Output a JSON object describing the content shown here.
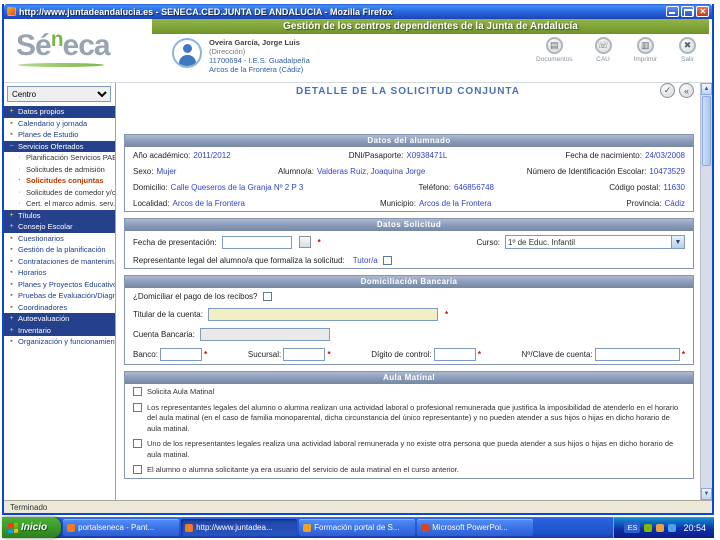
{
  "window": {
    "title": "http://www.juntadeandalucia.es - SENECA.CED.JUNTA DE ANDALUCIA - Mozilla Firefox"
  },
  "header": {
    "banner": "Gestión de los centros dependientes de la Junta de Andalucía",
    "logo": {
      "p1": "Sé",
      "p2": "n",
      "p3": "eca"
    },
    "user": {
      "name": "Oveira García, Jorge Luis",
      "role": "(Dirección)",
      "center": "11700694 - I.E.S. Guadalpeña",
      "location": "Arcos de la Frontera (Cádiz)"
    },
    "actions": [
      {
        "label": "Documentos",
        "glyph": "▤"
      },
      {
        "label": "CAU",
        "glyph": "☏"
      },
      {
        "label": "Imprimir",
        "glyph": "▥"
      },
      {
        "label": "Salir",
        "glyph": "✖"
      }
    ]
  },
  "sidebar": {
    "selector_value": "Centro",
    "items": [
      {
        "label": "Datos propios",
        "type": "dark",
        "prefix": "+"
      },
      {
        "label": "Calendario y jornada",
        "type": "link",
        "prefix": "▪"
      },
      {
        "label": "Planes de Estudio",
        "type": "link",
        "prefix": "▪"
      },
      {
        "label": "Servicios Ofertados",
        "type": "dark",
        "prefix": "−"
      },
      {
        "label": "Planificación Servicios PAE",
        "type": "sub",
        "prefix": "·"
      },
      {
        "label": "Solicitudes de admisión",
        "type": "sub",
        "prefix": "·"
      },
      {
        "label": "Solicitudes conjuntas",
        "type": "subsel",
        "prefix": "·"
      },
      {
        "label": "Solicitudes de comedor y/o aula",
        "type": "sub",
        "prefix": "·"
      },
      {
        "label": "Cert. el marco admis. serv. compl.",
        "type": "sub",
        "prefix": "·"
      },
      {
        "label": "Títulos",
        "type": "dark",
        "prefix": "+"
      },
      {
        "label": "Consejo Escolar",
        "type": "dark",
        "prefix": "+"
      },
      {
        "label": "Cuestionarios",
        "type": "link",
        "prefix": "▪"
      },
      {
        "label": "Gestión de la planificación",
        "type": "link",
        "prefix": "▪"
      },
      {
        "label": "Contrataciones de mantenim.",
        "type": "link",
        "prefix": "▪"
      },
      {
        "label": "Horarios",
        "type": "link",
        "prefix": "▪"
      },
      {
        "label": "Planes y Proyectos Educativos",
        "type": "link",
        "prefix": "▪"
      },
      {
        "label": "Pruebas de Evaluación/Diagnóstico",
        "type": "link",
        "prefix": "▪"
      },
      {
        "label": "Coordinadores",
        "type": "link",
        "prefix": "▪"
      },
      {
        "label": "Autoevaluación",
        "type": "dark",
        "prefix": "+"
      },
      {
        "label": "Inventario",
        "type": "dark",
        "prefix": "+"
      },
      {
        "label": "Organización y funcionamiento de bibl.",
        "type": "link",
        "prefix": "▪"
      }
    ]
  },
  "main": {
    "title": "DETALLE DE LA SOLICITUD CONJUNTA",
    "accept_icon": "✓",
    "back_icon": "«",
    "required": "*",
    "student": {
      "title": "Datos del alumnado",
      "fields": [
        {
          "label": "Año académico:",
          "value": "2011/2012"
        },
        {
          "label": "DNI/Pasaporte:",
          "value": "X0938471L"
        },
        {
          "label": "Fecha de nacimiento:",
          "value": "24/03/2008"
        },
        {
          "label": "Sexo:",
          "value": "Mujer"
        },
        {
          "label": "Alumno/a:",
          "value": "Valderas Ruiz, Joaquina Jorge"
        },
        {
          "label": "Número de Identificación Escolar:",
          "value": "10473529"
        },
        {
          "label": "Domicilio:",
          "value": "Calle Queseros de la Granja Nº 2 P 3"
        },
        {
          "label": "Teléfono:",
          "value": "646856748"
        },
        {
          "label": "Código postal:",
          "value": "11630"
        },
        {
          "label": "Localidad:",
          "value": "Arcos de la Frontera"
        },
        {
          "label": "Municipio:",
          "value": "Arcos de la Frontera"
        },
        {
          "label": "Provincia:",
          "value": "Cádiz"
        }
      ]
    },
    "request": {
      "title": "Datos Solicitud",
      "fecha_label": "Fecha de presentación:",
      "curso_label": "Curso:",
      "curso_value": "1º de Educ. Infantil",
      "rep_label": "Representante legal del alumno/a que formaliza la solicitud:",
      "rep_value": "Tutor/a"
    },
    "bank": {
      "title": "Domiciliación Bancaria",
      "question": "¿Domiciliar el pago de los recibos?",
      "titular_label": "Titular de la cuenta:",
      "cuenta_label": "Cuenta Bancaria:",
      "banco_label": "Banco:",
      "sucursal_label": "Sucursal:",
      "digito_label": "Dígito de control:",
      "clave_label": "Nº/Clave de cuenta:"
    },
    "matinal": {
      "title": "Aula Matinal",
      "options": [
        "Solicita Aula Matinal",
        "Los representantes legales del alumno o alumna realizan una actividad laboral o profesional remunerada que justifica la imposibilidad de atenderlo en el horario del aula matinal (en el caso de familia monoparental, dicha circunstancia del único representante) y no pueden atender a sus hijos o hijas en dicho horario de aula matinal.",
        "Uno de los representantes legales realiza una actividad laboral remunerada y no existe otra persona que pueda atender a sus hijos o hijas en dicho horario de aula matinal.",
        "El alumno o alumna solicitante ya era usuario del servicio de aula matinal en el curso anterior."
      ]
    }
  },
  "statusbar": {
    "text": "Terminado"
  },
  "taskbar": {
    "start_label": "Inicio",
    "buttons": [
      {
        "label": "portalseneca - Pant...",
        "active": "",
        "icon": "#F47B20"
      },
      {
        "label": "http://www.juntadea...",
        "active": "active",
        "icon": "#F47B20"
      },
      {
        "label": "Formación portal de S...",
        "active": "",
        "icon": "#F4A020"
      },
      {
        "label": "Microsoft PowerPoi...",
        "active": "",
        "icon": "#D24726"
      }
    ],
    "tray_lang": "ES",
    "clock": "20:54"
  }
}
